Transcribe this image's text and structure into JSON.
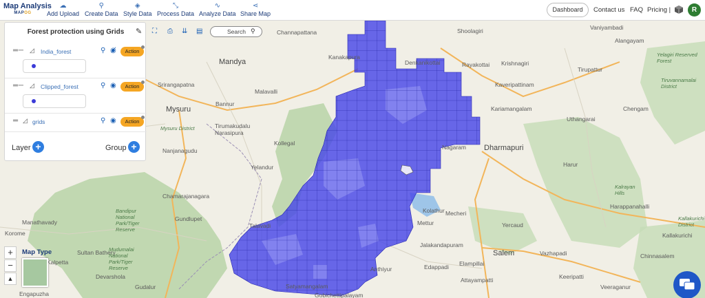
{
  "app": {
    "logo_title": "Map Analysis",
    "logo_sub_a": "MAP",
    "logo_sub_b": "OG"
  },
  "nav": [
    {
      "label": "Add Upload",
      "icon": "cloud-upload-icon"
    },
    {
      "label": "Create Data",
      "icon": "location-pin-icon"
    },
    {
      "label": "Style Data",
      "icon": "paint-bucket-icon"
    },
    {
      "label": "Process Data",
      "icon": "process-icon"
    },
    {
      "label": "Analyze Data",
      "icon": "chart-line-icon"
    },
    {
      "label": "Share Map",
      "icon": "share-icon"
    }
  ],
  "header_right": {
    "dashboard": "Dashboard",
    "contact": "Contact us",
    "faq": "FAQ",
    "pricing": "Pricing |",
    "avatar_letter": "R"
  },
  "panel": {
    "title": "Forest protection using Grids",
    "layers": [
      {
        "name": "India_forest",
        "action": "Action",
        "visible": false,
        "color": "#3b3bd8"
      },
      {
        "name": "Clipped_forest",
        "action": "Action",
        "visible": true,
        "color": "#3b3bd8"
      },
      {
        "name": "grids",
        "action": "Action",
        "visible": true
      }
    ],
    "layer_label": "Layer",
    "group_label": "Group"
  },
  "search": {
    "label": "Search"
  },
  "map": {
    "map_type_label": "Map Type",
    "zoom_in": "+",
    "zoom_out": "−",
    "places": [
      "Channapattana",
      "Mandya",
      "Kanakapura",
      "Denkanikottai",
      "Rayakottai",
      "Shoolagiri",
      "Krishnagiri",
      "Tirupattur",
      "Vaniyambadi",
      "Alangayam",
      "Srirangapatna",
      "Malavalli",
      "Kaveripattinam",
      "Mysuru",
      "Bannur",
      "Kariamangalam",
      "Chengam",
      "Tirumakudalu Narasipura",
      "Kollegal",
      "Uthangarai",
      "Dharmapuri",
      "Nanjanagudu",
      "Yelandur",
      "Harur",
      "Chamarajanagara",
      "Gundlupet",
      "Kolathur",
      "Mecheri",
      "Yercaud",
      "Manathavady",
      "Mettur",
      "Jalakandapuram",
      "Salem",
      "Vazhapadi",
      "Sultan Bathery",
      "Kalpetta",
      "Devarshola",
      "Gudalur",
      "Edappadi",
      "Elampillai",
      "Attayampatti",
      "Chinnasalem",
      "Anthiyur",
      "Satyamangalam",
      "Keeripatti",
      "Veeraganur",
      "Gobichettipalayam",
      "Engapuzha",
      "Korome",
      "Nagaram",
      "Harappanahalli",
      "Talavadi",
      "Kallakurichi"
    ],
    "regions": [
      "Mysuru District",
      "Bandipur National Park/Tiger Reserve",
      "Mudumalai National Park/Tiger Reserve",
      "Kalrayan Hills",
      "Tiruvannamalai District",
      "Kallakurichi District",
      "Yelagiri Reserved Forest"
    ]
  }
}
